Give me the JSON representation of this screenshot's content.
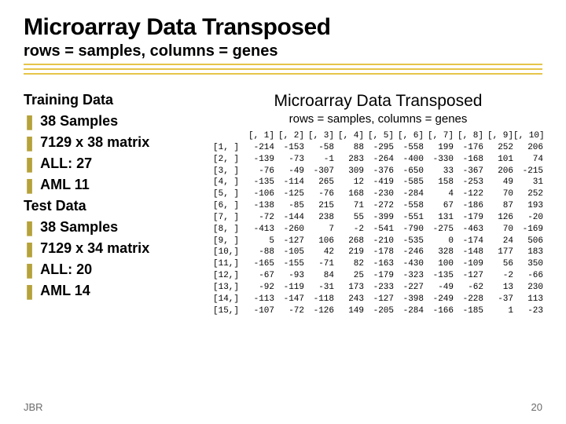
{
  "title": "Microarray Data Transposed",
  "subtitle": "rows = samples, columns = genes",
  "left": {
    "heading1": "Training Data",
    "items1": [
      "38 Samples",
      "7129 x 38 matrix",
      "ALL: 27",
      "AML 11"
    ],
    "heading2": "Test Data",
    "items2": [
      "38 Samples",
      "7129 x 34 matrix",
      "ALL: 20",
      "AML 14"
    ]
  },
  "right": {
    "title": "Microarray Data Transposed",
    "subtitle": "rows = samples, columns = genes"
  },
  "chart_data": {
    "type": "table",
    "col_headers": [
      "[, 1]",
      "[, 2]",
      "[, 3]",
      "[, 4]",
      "[, 5]",
      "[, 6]",
      "[, 7]",
      "[, 8]",
      "[, 9]",
      "[, 10]"
    ],
    "row_headers": [
      "[1, ]",
      "[2, ]",
      "[3, ]",
      "[4, ]",
      "[5, ]",
      "[6, ]",
      "[7, ]",
      "[8, ]",
      "[9, ]",
      "[10,]",
      "[11,]",
      "[12,]",
      "[13,]",
      "[14,]",
      "[15,]"
    ],
    "values": [
      [
        -214,
        -153,
        -58,
        88,
        -295,
        -558,
        199,
        -176,
        252,
        206
      ],
      [
        -139,
        -73,
        -1,
        283,
        -264,
        -400,
        -330,
        -168,
        101,
        74
      ],
      [
        -76,
        -49,
        -307,
        309,
        -376,
        -650,
        33,
        -367,
        206,
        -215
      ],
      [
        -135,
        -114,
        265,
        12,
        -419,
        -585,
        158,
        -253,
        49,
        31
      ],
      [
        -106,
        -125,
        -76,
        168,
        -230,
        -284,
        4,
        -122,
        70,
        252
      ],
      [
        -138,
        -85,
        215,
        71,
        -272,
        -558,
        67,
        -186,
        87,
        193
      ],
      [
        -72,
        -144,
        238,
        55,
        -399,
        -551,
        131,
        -179,
        126,
        -20
      ],
      [
        -413,
        -260,
        7,
        -2,
        -541,
        -790,
        -275,
        -463,
        70,
        -169
      ],
      [
        5,
        -127,
        106,
        268,
        -210,
        -535,
        0,
        -174,
        24,
        506
      ],
      [
        -88,
        -105,
        42,
        219,
        -178,
        -246,
        328,
        -148,
        177,
        183
      ],
      [
        -165,
        -155,
        -71,
        82,
        -163,
        -430,
        100,
        -109,
        56,
        350
      ],
      [
        -67,
        -93,
        84,
        25,
        -179,
        -323,
        -135,
        -127,
        -2,
        -66
      ],
      [
        -92,
        -119,
        -31,
        173,
        -233,
        -227,
        -49,
        -62,
        13,
        230
      ],
      [
        -113,
        -147,
        -118,
        243,
        -127,
        -398,
        -249,
        -228,
        -37,
        113
      ],
      [
        -107,
        -72,
        -126,
        149,
        -205,
        -284,
        -166,
        -185,
        1,
        -23
      ]
    ]
  },
  "footer": {
    "left": "JBR",
    "right": "20"
  }
}
